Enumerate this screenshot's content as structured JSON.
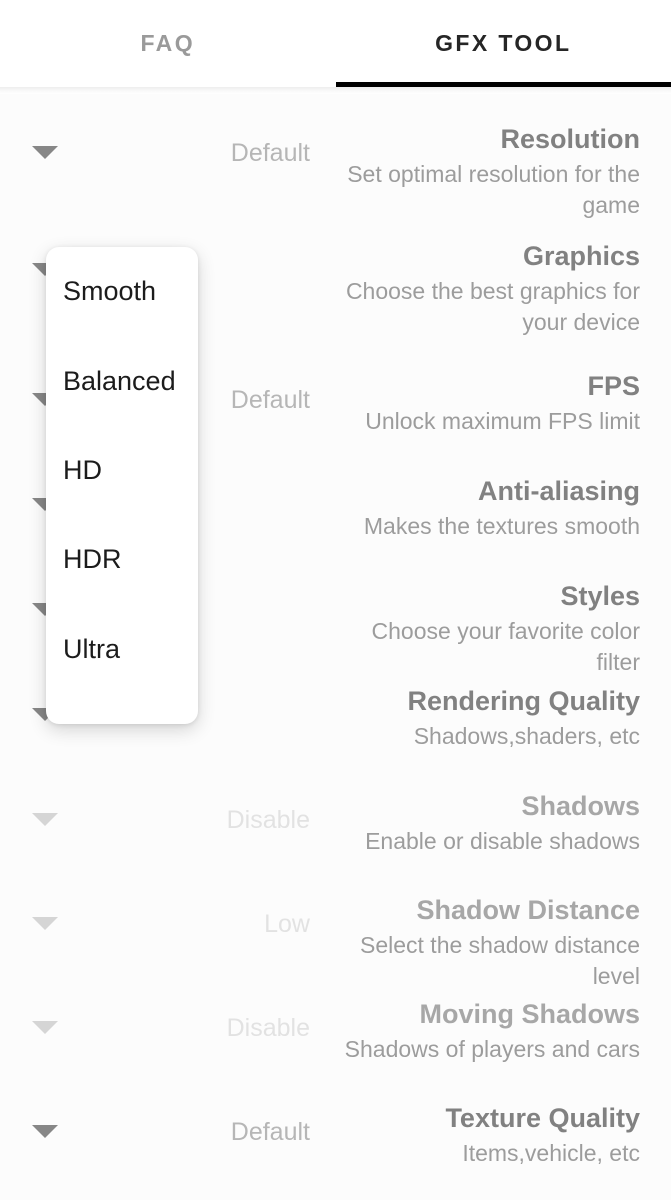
{
  "tabs": [
    {
      "label": "FAQ",
      "active": false
    },
    {
      "label": "GFX TOOL",
      "active": true
    }
  ],
  "settings": [
    {
      "title": "Resolution",
      "subtitle": "Set optimal resolution for the game",
      "value": "Default",
      "arrow": "chevron-down-icon",
      "faded": false
    },
    {
      "title": "Graphics",
      "subtitle": "Choose the best graphics for your device",
      "value": "",
      "arrow": "chevron-down-icon",
      "faded": false
    },
    {
      "title": "FPS",
      "subtitle": "Unlock maximum FPS limit",
      "value": "Default",
      "arrow": "chevron-down-icon",
      "faded": false
    },
    {
      "title": "Anti-aliasing",
      "subtitle": "Makes the textures smooth",
      "value": "",
      "arrow": "chevron-down-icon",
      "faded": false
    },
    {
      "title": "Styles",
      "subtitle": "Choose your favorite color filter",
      "value": "",
      "arrow": "chevron-down-icon",
      "faded": false
    },
    {
      "title": "Rendering Quality",
      "subtitle": "Shadows,shaders, etc",
      "value": "",
      "arrow": "chevron-down-icon",
      "faded": false
    },
    {
      "title": "Shadows",
      "subtitle": "Enable or disable shadows",
      "value": "Disable",
      "arrow": "chevron-down-icon",
      "faded": true
    },
    {
      "title": "Shadow Distance",
      "subtitle": "Select the shadow distance level",
      "value": "Low",
      "arrow": "chevron-down-icon",
      "faded": true
    },
    {
      "title": "Moving Shadows",
      "subtitle": "Shadows of players and cars",
      "value": "Disable",
      "arrow": "chevron-down-icon",
      "faded": true
    },
    {
      "title": "Texture Quality",
      "subtitle": "Items,vehicle, etc",
      "value": "Default",
      "arrow": "chevron-down-icon",
      "faded": false
    }
  ],
  "dropdown": {
    "open": true,
    "options": [
      "Smooth",
      "Balanced",
      "HD",
      "HDR",
      "Ultra"
    ]
  },
  "colors": {
    "accent": "#000000",
    "tab_active_text": "#262626",
    "tab_inactive_text": "#9a9a9a",
    "row_title": "#555555",
    "row_subtitle": "#7b7b7b",
    "row_value": "#9e9e9e",
    "row_value_faded": "#dcdcdc",
    "page_background": "#ffffff",
    "dropdown_background": "#ffffff",
    "dropdown_text": "#1c1c1c"
  }
}
